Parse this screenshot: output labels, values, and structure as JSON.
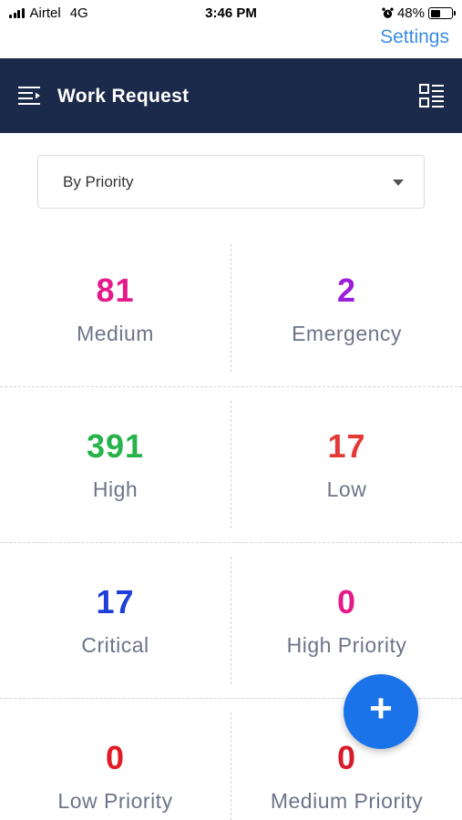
{
  "status_bar": {
    "carrier": "Airtel",
    "network": "4G",
    "time": "3:46 PM",
    "battery": "48%",
    "battery_level": 0.48
  },
  "top_link": {
    "settings_label": "Settings"
  },
  "header": {
    "title": "Work Request",
    "menu_icon": "menu-icon",
    "list_icon": "list-view-icon"
  },
  "filter": {
    "selected": "By Priority"
  },
  "tiles": [
    {
      "count": "81",
      "label": "Medium",
      "color": "#e5198a"
    },
    {
      "count": "2",
      "label": "Emergency",
      "color": "#9b1ed9"
    },
    {
      "count": "391",
      "label": "High",
      "color": "#27b24a"
    },
    {
      "count": "17",
      "label": "Low",
      "color": "#e53935"
    },
    {
      "count": "17",
      "label": "Critical",
      "color": "#1e40d8"
    },
    {
      "count": "0",
      "label": "High Priority",
      "color": "#e5198a"
    },
    {
      "count": "0",
      "label": "Low Priority",
      "color": "#e01b24"
    },
    {
      "count": "0",
      "label": "Medium Priority",
      "color": "#d81b2a"
    }
  ],
  "fab": {
    "label": "+",
    "color": "#1a73e8"
  },
  "colors": {
    "header_bg": "#1b2a4a",
    "settings_link": "#3a8de0",
    "label_text": "#6e7489"
  }
}
